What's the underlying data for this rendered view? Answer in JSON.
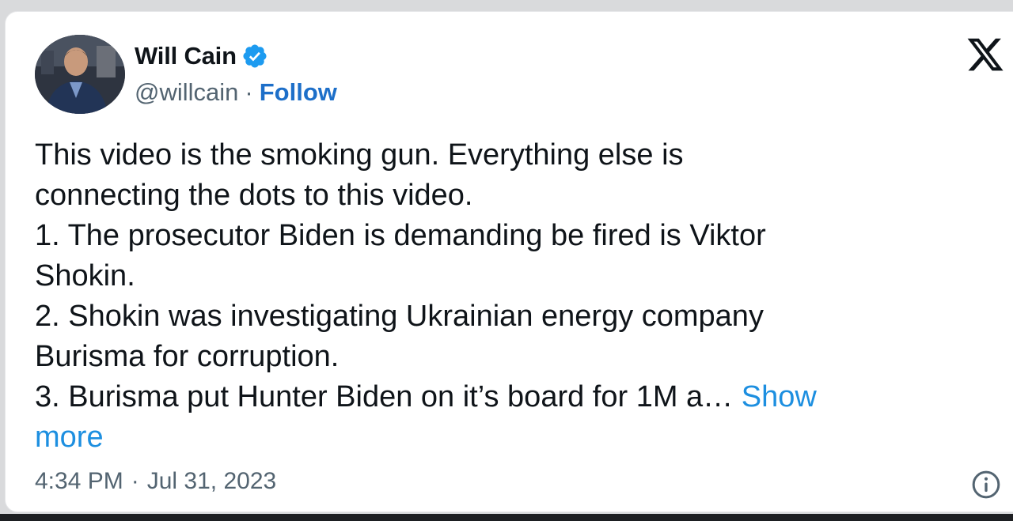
{
  "author": {
    "name": "Will Cain",
    "handle": "@willcain",
    "separator": "·",
    "follow_label": "Follow",
    "verified_color": "#1d9bf0"
  },
  "tweet": {
    "lines": [
      "This video is the smoking gun. Everything else is",
      "connecting the dots to this video.",
      "1. The prosecutor Biden is demanding be fired is Viktor",
      "Shokin.",
      "2. Shokin was investigating Ukrainian energy company",
      "Burisma for corruption.",
      "3. Burisma put Hunter Biden on it’s board for 1M a…"
    ],
    "show_more_part1": "Show",
    "show_more_part2": "more"
  },
  "meta": {
    "time": "4:34 PM",
    "separator": "·",
    "date": "Jul 31, 2023"
  },
  "icons": {
    "platform": "x-logo-icon",
    "info": "info-icon",
    "verified": "verified-badge-icon"
  },
  "colors": {
    "link": "#1d8fe0",
    "follow": "#1d6fc9",
    "secondary_text": "#536471",
    "primary_text": "#0f1419"
  }
}
